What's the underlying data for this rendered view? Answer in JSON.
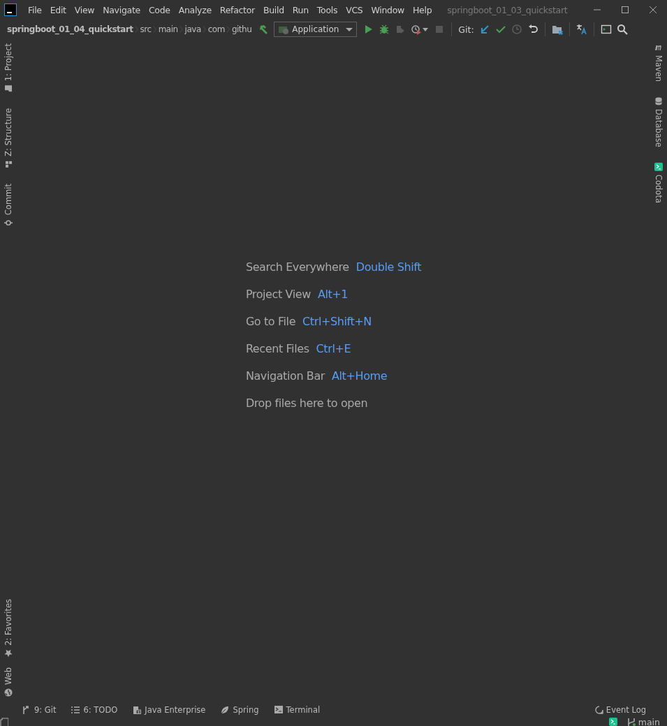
{
  "window": {
    "title": "springboot_01_03_quickstart"
  },
  "menu": [
    "File",
    "Edit",
    "View",
    "Navigate",
    "Code",
    "Analyze",
    "Refactor",
    "Build",
    "Run",
    "Tools",
    "VCS",
    "Window",
    "Help"
  ],
  "breadcrumb": [
    "springboot_01_04_quickstart",
    "src",
    "main",
    "java",
    "com",
    "githu"
  ],
  "run_config": {
    "label": "Application"
  },
  "vcs_label": "Git:",
  "left_tools_top": [
    "1: Project",
    "Z: Structure",
    "Commit"
  ],
  "left_tools_bottom": [
    "2: Favorites",
    "Web"
  ],
  "right_tools": [
    "Maven",
    "Database",
    "Codota"
  ],
  "welcome": [
    {
      "action": "Search Everywhere",
      "shortcut": "Double Shift"
    },
    {
      "action": "Project View",
      "shortcut": "Alt+1"
    },
    {
      "action": "Go to File",
      "shortcut": "Ctrl+Shift+N"
    },
    {
      "action": "Recent Files",
      "shortcut": "Ctrl+E"
    },
    {
      "action": "Navigation Bar",
      "shortcut": "Alt+Home"
    },
    {
      "action": "Drop files here to open"
    }
  ],
  "bottom_tools": [
    "9: Git",
    "6: TODO",
    "Java Enterprise",
    "Spring",
    "Terminal"
  ],
  "event_log": "Event Log",
  "status": {
    "branch": "main"
  }
}
